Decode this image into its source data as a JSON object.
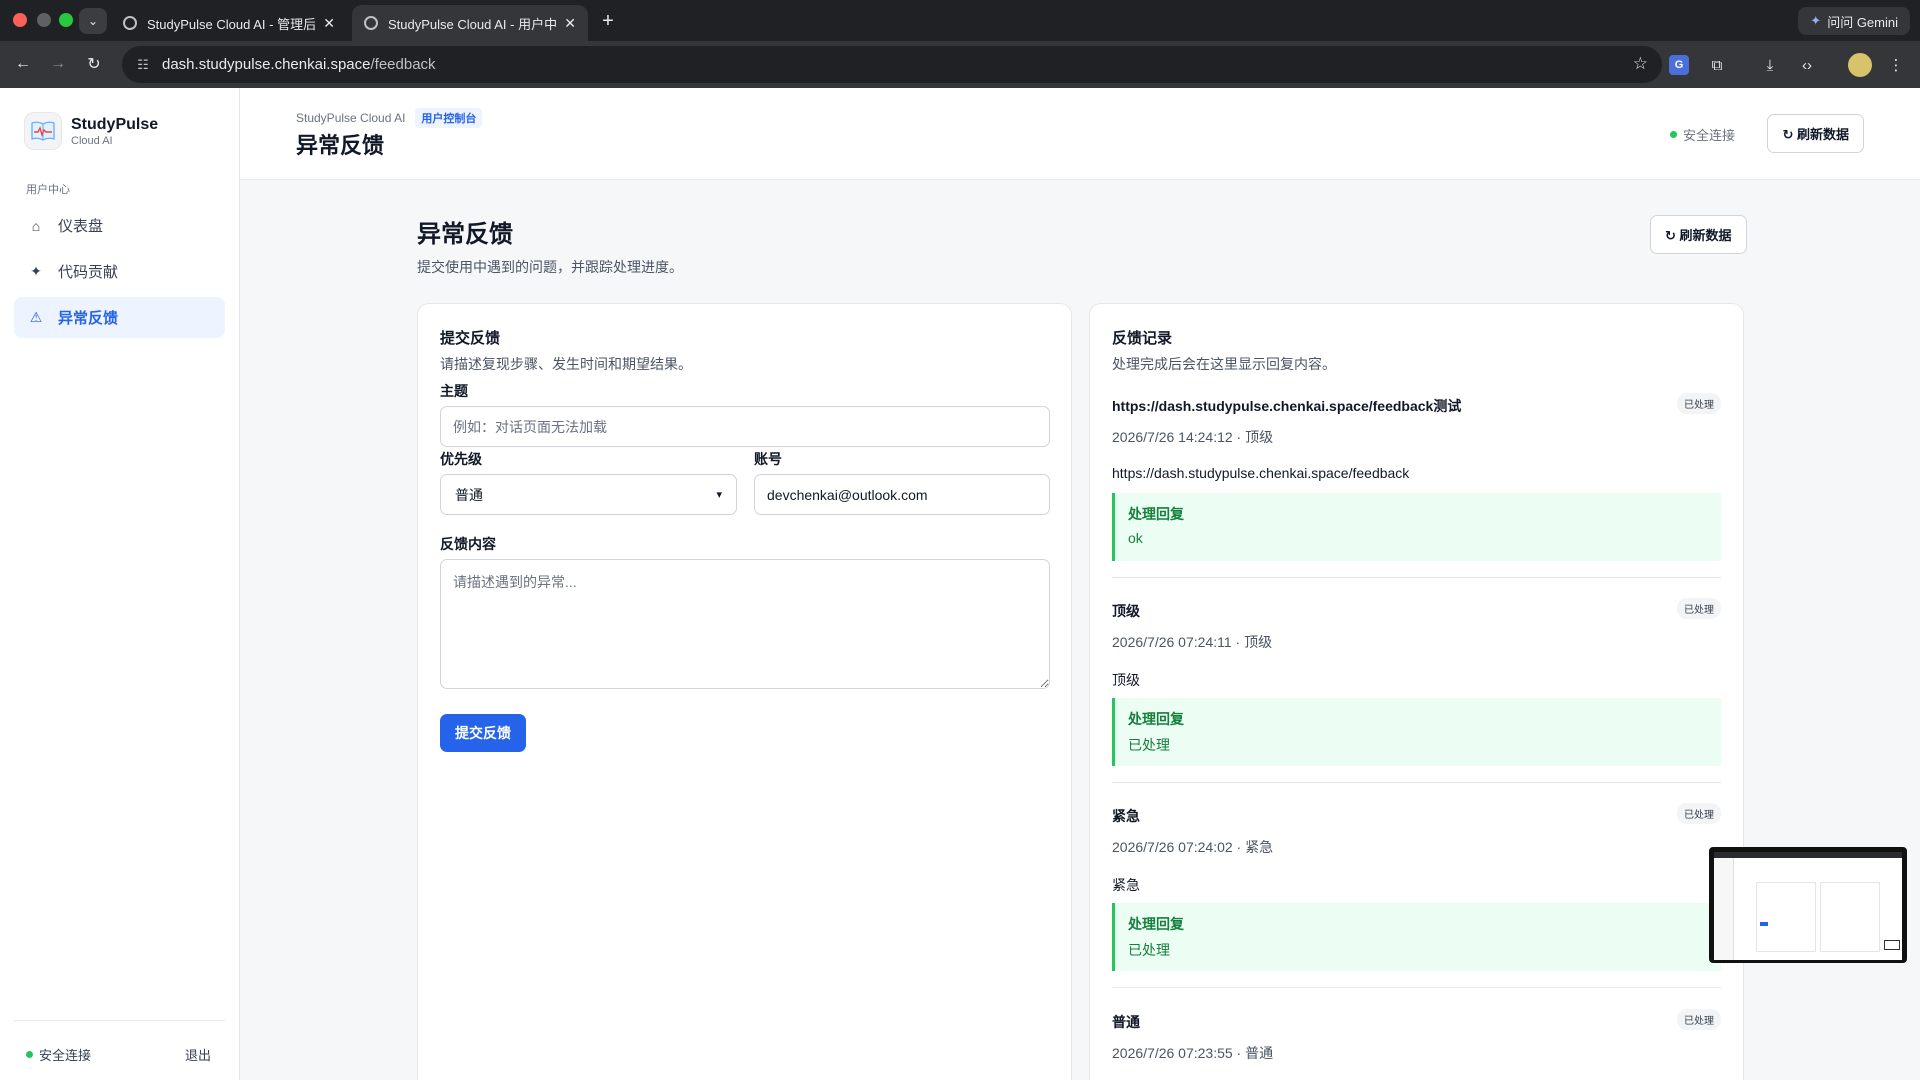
{
  "browser": {
    "tabs": [
      {
        "title": "StudyPulse Cloud AI - 管理后台"
      },
      {
        "title": "StudyPulse Cloud AI - 用户中心"
      }
    ],
    "gemini_label": "问问 Gemini",
    "url_host": "dash.studypulse.chenkai.space",
    "url_path": "/feedback"
  },
  "sidebar": {
    "brand_name": "StudyPulse",
    "brand_sub": "Cloud AI",
    "section_label": "用户中心",
    "items": [
      {
        "label": "仪表盘",
        "icon": "home-icon",
        "active": false
      },
      {
        "label": "代码贡献",
        "icon": "sparkle-icon",
        "active": false
      },
      {
        "label": "异常反馈",
        "icon": "warning-icon",
        "active": true
      }
    ],
    "status": "安全连接",
    "logout": "退出"
  },
  "topbar": {
    "crumb": "StudyPulse Cloud AI",
    "badge": "用户控制台",
    "title": "异常反馈",
    "status": "安全连接",
    "refresh_label": "↻ 刷新数据"
  },
  "page": {
    "title": "异常反馈",
    "description": "提交使用中遇到的问题，并跟踪处理进度。",
    "refresh_label": "↻ 刷新数据"
  },
  "form": {
    "title": "提交反馈",
    "description": "请描述复现步骤、发生时间和期望结果。",
    "subject_label": "主题",
    "subject_placeholder": "例如：对话页面无法加载",
    "priority_label": "优先级",
    "priority_value": "普通",
    "account_label": "账号",
    "account_value": "devchenkai@outlook.com",
    "content_label": "反馈内容",
    "content_placeholder": "请描述遇到的异常...",
    "submit_label": "提交反馈"
  },
  "records": {
    "title": "反馈记录",
    "description": "处理完成后会在这里显示回复内容。",
    "reply_label": "处理回复",
    "items": [
      {
        "title": "https://dash.studypulse.chenkai.space/feedback测试",
        "status": "已处理",
        "meta": "2026/7/26 14:24:12 · 顶级",
        "body": "https://dash.studypulse.chenkai.space/feedback",
        "reply": "ok"
      },
      {
        "title": "顶级",
        "status": "已处理",
        "meta": "2026/7/26 07:24:11 · 顶级",
        "body": "顶级",
        "reply": "已处理"
      },
      {
        "title": "紧急",
        "status": "已处理",
        "meta": "2026/7/26 07:24:02 · 紧急",
        "body": "紧急",
        "reply": "已处理"
      },
      {
        "title": "普通",
        "status": "已处理",
        "meta": "2026/7/26 07:23:55 · 普通",
        "body": "",
        "reply": ""
      }
    ]
  },
  "colors": {
    "accent": "#2563eb",
    "success": "#22c55e",
    "reply_bg": "#ecfdf3"
  }
}
